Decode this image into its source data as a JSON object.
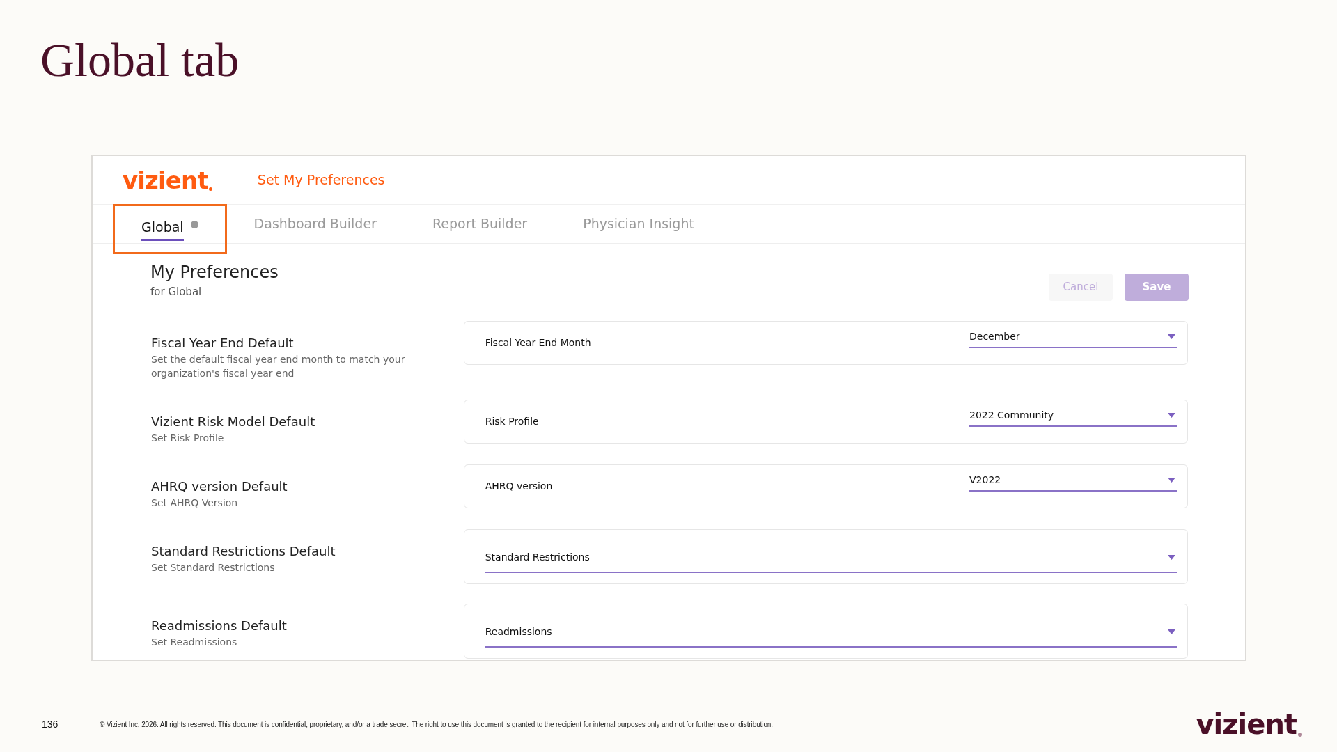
{
  "slide": {
    "title": "Global tab",
    "page_number": "136",
    "copyright": "© Vizient Inc, 2026. All rights reserved. This document is confidential, proprietary, and/or a trade secret. The right to use this document is granted to the recipient for internal purposes only and not for further use or distribution.",
    "footer_logo": "vizient"
  },
  "app": {
    "logo": "vizient",
    "header_title": "Set My Preferences",
    "tabs": [
      {
        "label": "Global",
        "selected": true,
        "info": true,
        "callout": true
      },
      {
        "label": "Dashboard Builder",
        "selected": false,
        "info": false,
        "callout": false
      },
      {
        "label": "Report Builder",
        "selected": false,
        "info": false,
        "callout": false
      },
      {
        "label": "Physician Insight",
        "selected": false,
        "info": false,
        "callout": false
      }
    ],
    "heading": "My Preferences",
    "subheading": "for Global",
    "buttons": [
      {
        "label": "Cancel",
        "kind": "secondary"
      },
      {
        "label": "Save",
        "kind": "primary"
      }
    ],
    "settings": [
      {
        "kind": "labeled",
        "title": "Fiscal Year End Default",
        "description": "Set the default fiscal year end month to match your organization's fiscal year end",
        "field_label": "Fiscal Year End Month",
        "value": "December"
      },
      {
        "kind": "labeled",
        "title": "Vizient Risk Model Default",
        "description": "Set Risk Profile",
        "field_label": "Risk Profile",
        "value": "2022 Community"
      },
      {
        "kind": "labeled",
        "title": "AHRQ version Default",
        "description": "Set AHRQ Version",
        "field_label": "AHRQ version",
        "value": "V2022"
      },
      {
        "kind": "wide",
        "title": "Standard Restrictions Default",
        "description": "Set Standard Restrictions",
        "placeholder": "Standard Restrictions"
      },
      {
        "kind": "wide",
        "title": "Readmissions Default",
        "description": "Set Readmissions",
        "placeholder": "Readmissions"
      }
    ]
  }
}
